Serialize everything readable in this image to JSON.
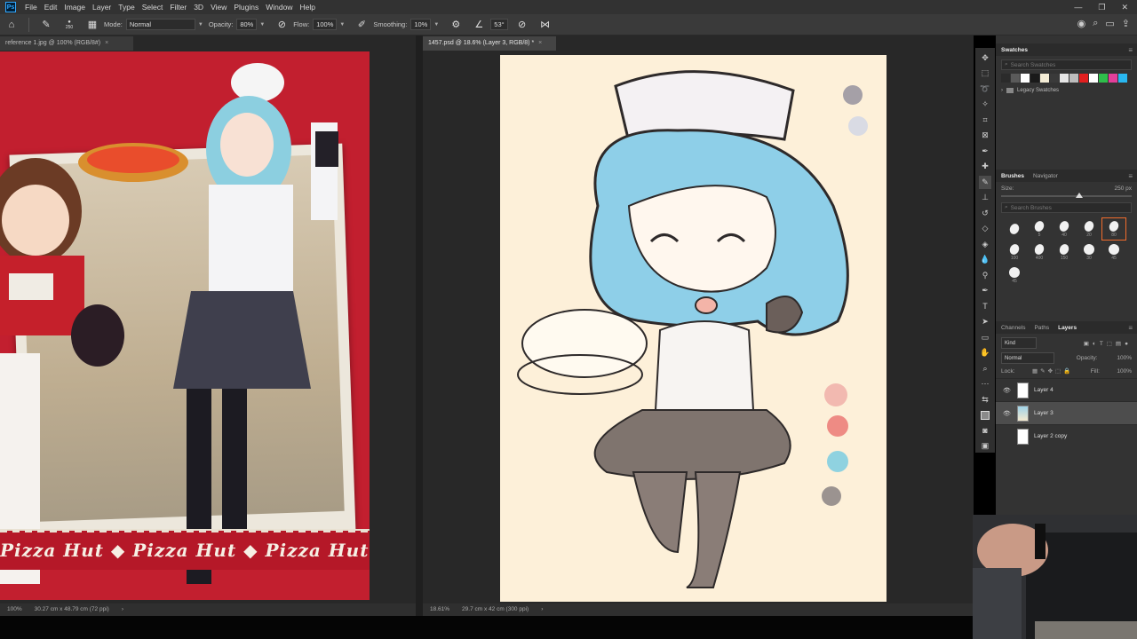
{
  "menu": {
    "app_icon": "Ps",
    "items": [
      "File",
      "Edit",
      "Image",
      "Layer",
      "Type",
      "Select",
      "Filter",
      "3D",
      "View",
      "Plugins",
      "Window",
      "Help"
    ]
  },
  "options": {
    "brush_size": "250",
    "mode_label": "Mode:",
    "mode_value": "Normal",
    "opacity_label": "Opacity:",
    "opacity_value": "80%",
    "flow_label": "Flow:",
    "flow_value": "100%",
    "smoothing_label": "Smoothing:",
    "smoothing_value": "10%",
    "angle_value": "53°"
  },
  "docs": {
    "left": {
      "tab": "reference 1.jpg @ 100% (RGB/8#)",
      "zoom": "100%",
      "size": "30.27 cm x 48.79 cm (72 ppi)"
    },
    "right": {
      "tab": "1457.psd @ 18.6% (Layer 3, RGB/8) *",
      "zoom": "18.61%",
      "size": "29.7 cm x 42 cm (300 ppi)"
    }
  },
  "reference": {
    "strip_text": "Pizza Hut ◆ Pizza Hut ◆ Pizza Hut ◆ Pi",
    "logo_text": "Pizza Hut"
  },
  "swatches": {
    "title": "Swatches",
    "search_placeholder": "Search Swatches",
    "colors": [
      "#2b2b2b",
      "#5a5a5a",
      "#ffffff",
      "#1a1a1a",
      "#f3ecd5",
      "#3a3a3a",
      "#e6e6e6",
      "#bcbcbc",
      "#e21f1f",
      "#ffffff",
      "#2fbd4b",
      "#e23f9a",
      "#29b7f0"
    ],
    "legacy": "Legacy Swatches"
  },
  "brushes": {
    "tabs": [
      "Brushes",
      "Navigator"
    ],
    "size_label": "Size:",
    "size_value": "250 px",
    "search_placeholder": "Search Brushes",
    "tips": [
      {
        "label": "",
        "round": false
      },
      {
        "label": "5",
        "round": false
      },
      {
        "label": "40",
        "round": false
      },
      {
        "label": "20",
        "round": false
      },
      {
        "label": "80",
        "round": false
      },
      {
        "label": "100",
        "round": false
      },
      {
        "label": "400",
        "round": false
      },
      {
        "label": "150",
        "round": false
      },
      {
        "label": "30",
        "round": true
      },
      {
        "label": "45",
        "round": true
      },
      {
        "label": "45",
        "round": true
      }
    ]
  },
  "layers": {
    "tabs": [
      "Channels",
      "Paths",
      "Layers"
    ],
    "kind": "Kind",
    "blend": "Normal",
    "opacity_label": "Opacity:",
    "opacity_value": "100%",
    "lock_label": "Lock:",
    "fill_label": "Fill:",
    "fill_value": "100%",
    "items": [
      {
        "name": "Layer 4",
        "selected": false
      },
      {
        "name": "Layer 3",
        "selected": true
      },
      {
        "name": "Layer 2 copy",
        "selected": false
      }
    ]
  }
}
